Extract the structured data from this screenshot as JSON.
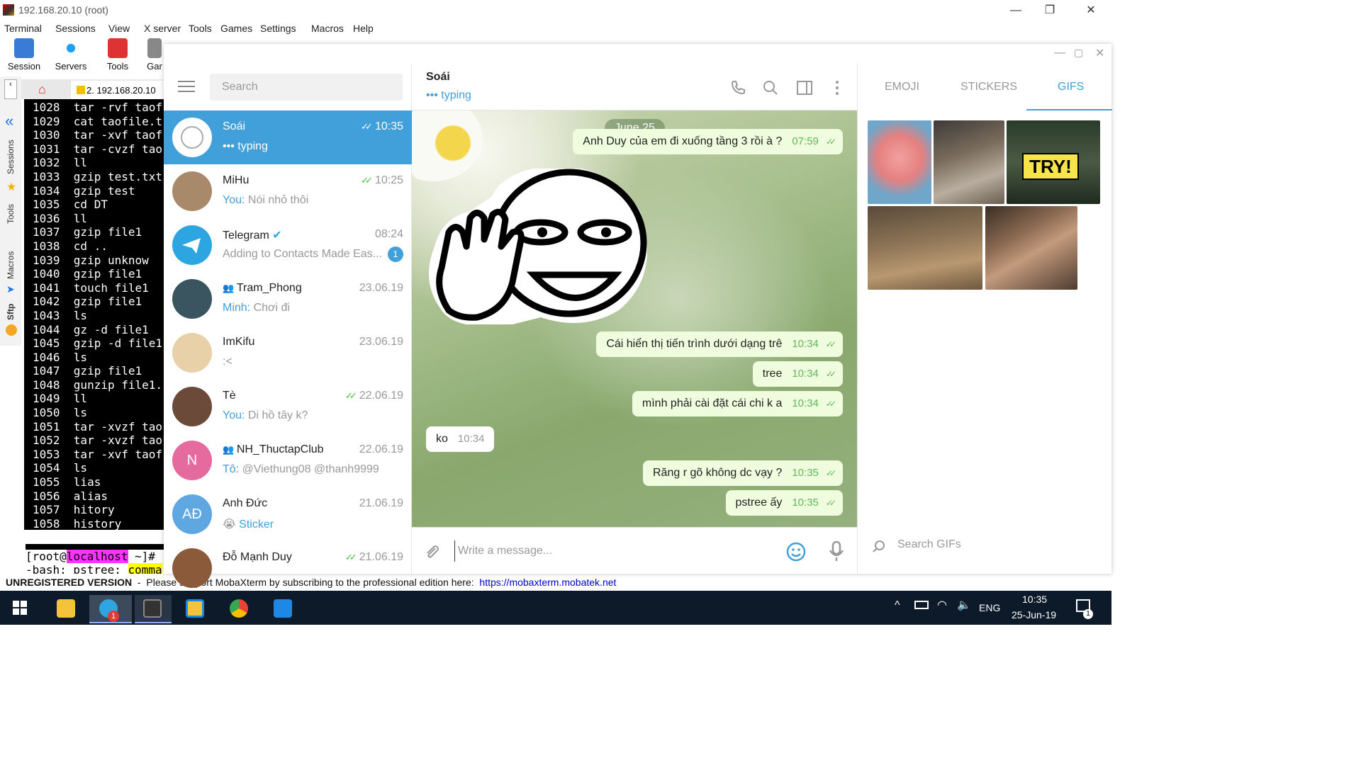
{
  "moba": {
    "title": "192.168.20.10 (root)",
    "menu": [
      "Terminal",
      "Sessions",
      "View",
      "X server",
      "Tools",
      "Games",
      "Settings",
      "Macros",
      "Help"
    ],
    "toolbar": [
      "Session",
      "Servers",
      "Tools",
      "Gar"
    ],
    "side_tabs": [
      "Sessions",
      "Tools",
      "Macros",
      "Sftp"
    ],
    "tab_label": "2. 192.168.20.10",
    "unregistered": "UNREGISTERED VERSION",
    "support_text": "Please support MobaXterm by subscribing to the professional edition here:",
    "support_link": "https://mobaxterm.mobatek.net"
  },
  "terminal": {
    "lines": [
      "1028  tar -rvf taof",
      "1029  cat taofile.t",
      "1030  tar -xvf taof",
      "1031  tar -cvzf tao",
      "1032  ll",
      "1033  gzip test.txt",
      "1034  gzip test",
      "1035  cd DT",
      "1036  ll",
      "1037  gzip file1",
      "1038  cd ..",
      "1039  gzip unknow",
      "1040  gzip file1",
      "1041  touch file1",
      "1042  gzip file1",
      "1043  ls",
      "1044  gz -d file1",
      "1045  gzip -d file1",
      "1046  ls",
      "1047  gzip file1",
      "1048  gunzip file1.",
      "1049  ll",
      "1050  ls",
      "1051  tar -xvzf tao",
      "1052  tar -xvzf tao",
      "1053  tar -xvf taof",
      "1054  ls",
      "1055  lias",
      "1056  alias",
      "1057  hitory",
      "1058  history"
    ],
    "prompt_user": "root",
    "prompt_host": "localhost",
    "prompt_rest": " ~]#",
    "bash_error_prefix": "-bash: pstree: ",
    "bash_error_hl": "comma"
  },
  "telegram": {
    "search_placeholder": "Search",
    "chats": [
      {
        "name": "Soái",
        "time": "10:35",
        "msg": "typing",
        "prefix": "••• ",
        "ticks": true,
        "active": true
      },
      {
        "name": "MiHu",
        "time": "10:25",
        "you": "You: ",
        "msg": "Nói nhỏ thôi",
        "ticks": true
      },
      {
        "name": "Telegram",
        "time": "08:24",
        "msg": "Adding to Contacts Made Eas...",
        "badge": "1",
        "verified": true
      },
      {
        "name": "Tram_Phong",
        "time": "23.06.19",
        "you": "Minh: ",
        "msg": "Chơi đi",
        "group": true
      },
      {
        "name": "ImKifu",
        "time": "23.06.19",
        "msg": ":<"
      },
      {
        "name": "Tè",
        "time": "22.06.19",
        "you": "You: ",
        "msg": "Di hồ tây k?",
        "ticks": true
      },
      {
        "name": "NH_ThuctapClub",
        "time": "22.06.19",
        "you": "Tô: ",
        "msg": "@Viethung08 @thanh9999",
        "group": true,
        "initial": "N"
      },
      {
        "name": "Anh Đức",
        "time": "21.06.19",
        "msg": "Sticker",
        "emoji": "😭",
        "initial": "AĐ"
      },
      {
        "name": "Đỗ Mạnh Duy",
        "time": "21.06.19",
        "msg": "",
        "ticks": true
      }
    ],
    "header": {
      "name": "Soái",
      "status": "typing",
      "status_prefix": "••• "
    },
    "date_pill": "June 25",
    "messages": [
      {
        "text": "Anh Duy của em đi xuống tầng 3 rồi à ?",
        "time": "07:59",
        "out": true
      },
      {
        "text": "Cái hiển thị tiến trình dưới dạng trê",
        "time": "10:34",
        "out": true
      },
      {
        "text": "tree",
        "time": "10:34",
        "out": true
      },
      {
        "text": "mình phải cài đặt cái chi k a",
        "time": "10:34",
        "out": true
      },
      {
        "text": "ko",
        "time": "10:34",
        "out": false
      },
      {
        "text": "Răng r gõ không dc vạy ?",
        "time": "10:35",
        "out": true
      },
      {
        "text": "pstree ấy",
        "time": "10:35",
        "out": true
      }
    ],
    "composer_placeholder": "Write a message...",
    "right_tabs": [
      "EMOJI",
      "STICKERS",
      "GIFS"
    ],
    "gif_search_placeholder": "Search GIFs",
    "gif_overlay_text": "TRY!"
  },
  "taskbar": {
    "lang": "ENG",
    "time": "10:35",
    "date": "25-Jun-19",
    "telegram_badge": "1",
    "notif_badge": "1"
  }
}
